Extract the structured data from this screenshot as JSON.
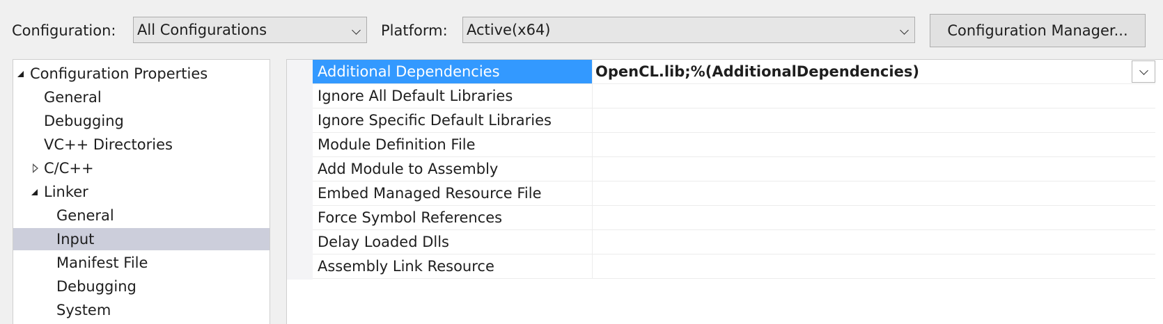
{
  "toolbar": {
    "configuration_label": "Configuration:",
    "configuration_value": "All Configurations",
    "platform_label": "Platform:",
    "platform_value": "Active(x64)",
    "config_manager_button": "Configuration Manager..."
  },
  "tree": {
    "items": [
      {
        "label": "Configuration Properties",
        "level": 0,
        "expander": "expanded",
        "selected": false
      },
      {
        "label": "General",
        "level": 1,
        "expander": "none",
        "selected": false
      },
      {
        "label": "Debugging",
        "level": 1,
        "expander": "none",
        "selected": false
      },
      {
        "label": "VC++ Directories",
        "level": 1,
        "expander": "none",
        "selected": false
      },
      {
        "label": "C/C++",
        "level": 1,
        "expander": "collapsed",
        "selected": false
      },
      {
        "label": "Linker",
        "level": 1,
        "expander": "expanded",
        "selected": false
      },
      {
        "label": "General",
        "level": 2,
        "expander": "none",
        "selected": false
      },
      {
        "label": "Input",
        "level": 2,
        "expander": "none",
        "selected": true
      },
      {
        "label": "Manifest File",
        "level": 2,
        "expander": "none",
        "selected": false
      },
      {
        "label": "Debugging",
        "level": 2,
        "expander": "none",
        "selected": false
      },
      {
        "label": "System",
        "level": 2,
        "expander": "none",
        "selected": false
      }
    ]
  },
  "properties": {
    "rows": [
      {
        "name": "Additional Dependencies",
        "value": "OpenCL.lib;%(AdditionalDependencies)",
        "selected": true
      },
      {
        "name": "Ignore All Default Libraries",
        "value": "",
        "selected": false
      },
      {
        "name": "Ignore Specific Default Libraries",
        "value": "",
        "selected": false
      },
      {
        "name": "Module Definition File",
        "value": "",
        "selected": false
      },
      {
        "name": "Add Module to Assembly",
        "value": "",
        "selected": false
      },
      {
        "name": "Embed Managed Resource File",
        "value": "",
        "selected": false
      },
      {
        "name": "Force Symbol References",
        "value": "",
        "selected": false
      },
      {
        "name": "Delay Loaded Dlls",
        "value": "",
        "selected": false
      },
      {
        "name": "Assembly Link Resource",
        "value": "",
        "selected": false
      }
    ]
  },
  "icons": {
    "combo_dropdown": "chevron-down-icon",
    "tree_expanded": "triangle-expanded-icon",
    "tree_collapsed": "triangle-collapsed-icon"
  },
  "colors": {
    "selection_blue": "#3399ff",
    "tree_selection": "#cccedb",
    "background": "#f0f0f0"
  }
}
